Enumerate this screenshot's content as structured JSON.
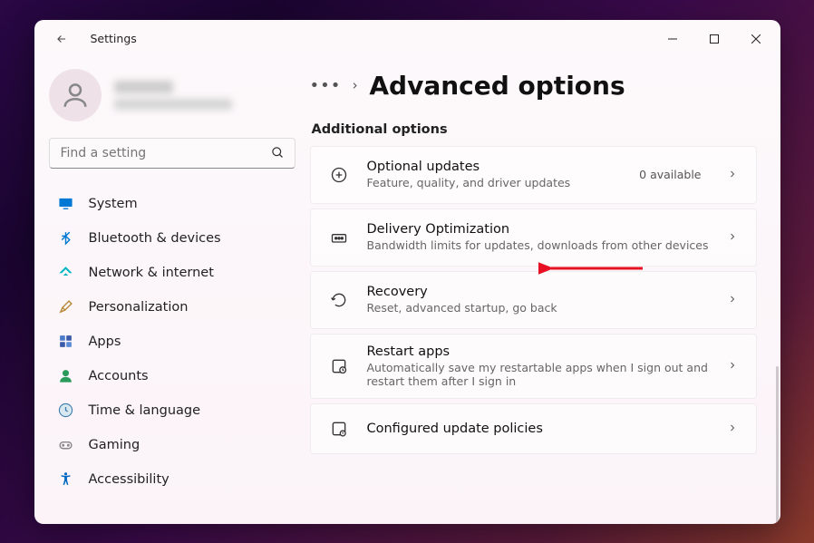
{
  "app_title": "Settings",
  "search_placeholder": "Find a setting",
  "nav": [
    {
      "label": "System",
      "icon": "monitor",
      "color": "#0078d4"
    },
    {
      "label": "Bluetooth & devices",
      "icon": "bluetooth",
      "color": "#0078d4"
    },
    {
      "label": "Network & internet",
      "icon": "wifi",
      "color": "#00b7c3"
    },
    {
      "label": "Personalization",
      "icon": "brush",
      "color": "#b88a3a"
    },
    {
      "label": "Apps",
      "icon": "apps",
      "color": "#3a5aa8"
    },
    {
      "label": "Accounts",
      "icon": "account",
      "color": "#2a9a5a"
    },
    {
      "label": "Time & language",
      "icon": "clock",
      "color": "#3a7aaa"
    },
    {
      "label": "Gaming",
      "icon": "gaming",
      "color": "#888"
    },
    {
      "label": "Accessibility",
      "icon": "accessibility",
      "color": "#0067c0"
    }
  ],
  "page": {
    "title": "Advanced options",
    "section": "Additional options",
    "cards": [
      {
        "icon": "plus-circle",
        "title": "Optional updates",
        "sub": "Feature, quality, and driver updates",
        "right": "0 available"
      },
      {
        "icon": "delivery",
        "title": "Delivery Optimization",
        "sub": "Bandwidth limits for updates, downloads from other devices",
        "right": ""
      },
      {
        "icon": "recovery",
        "title": "Recovery",
        "sub": "Reset, advanced startup, go back",
        "right": ""
      },
      {
        "icon": "restart",
        "title": "Restart apps",
        "sub": "Automatically save my restartable apps when I sign out and restart them after I sign in",
        "right": ""
      },
      {
        "icon": "policy",
        "title": "Configured update policies",
        "sub": "",
        "right": ""
      }
    ]
  }
}
